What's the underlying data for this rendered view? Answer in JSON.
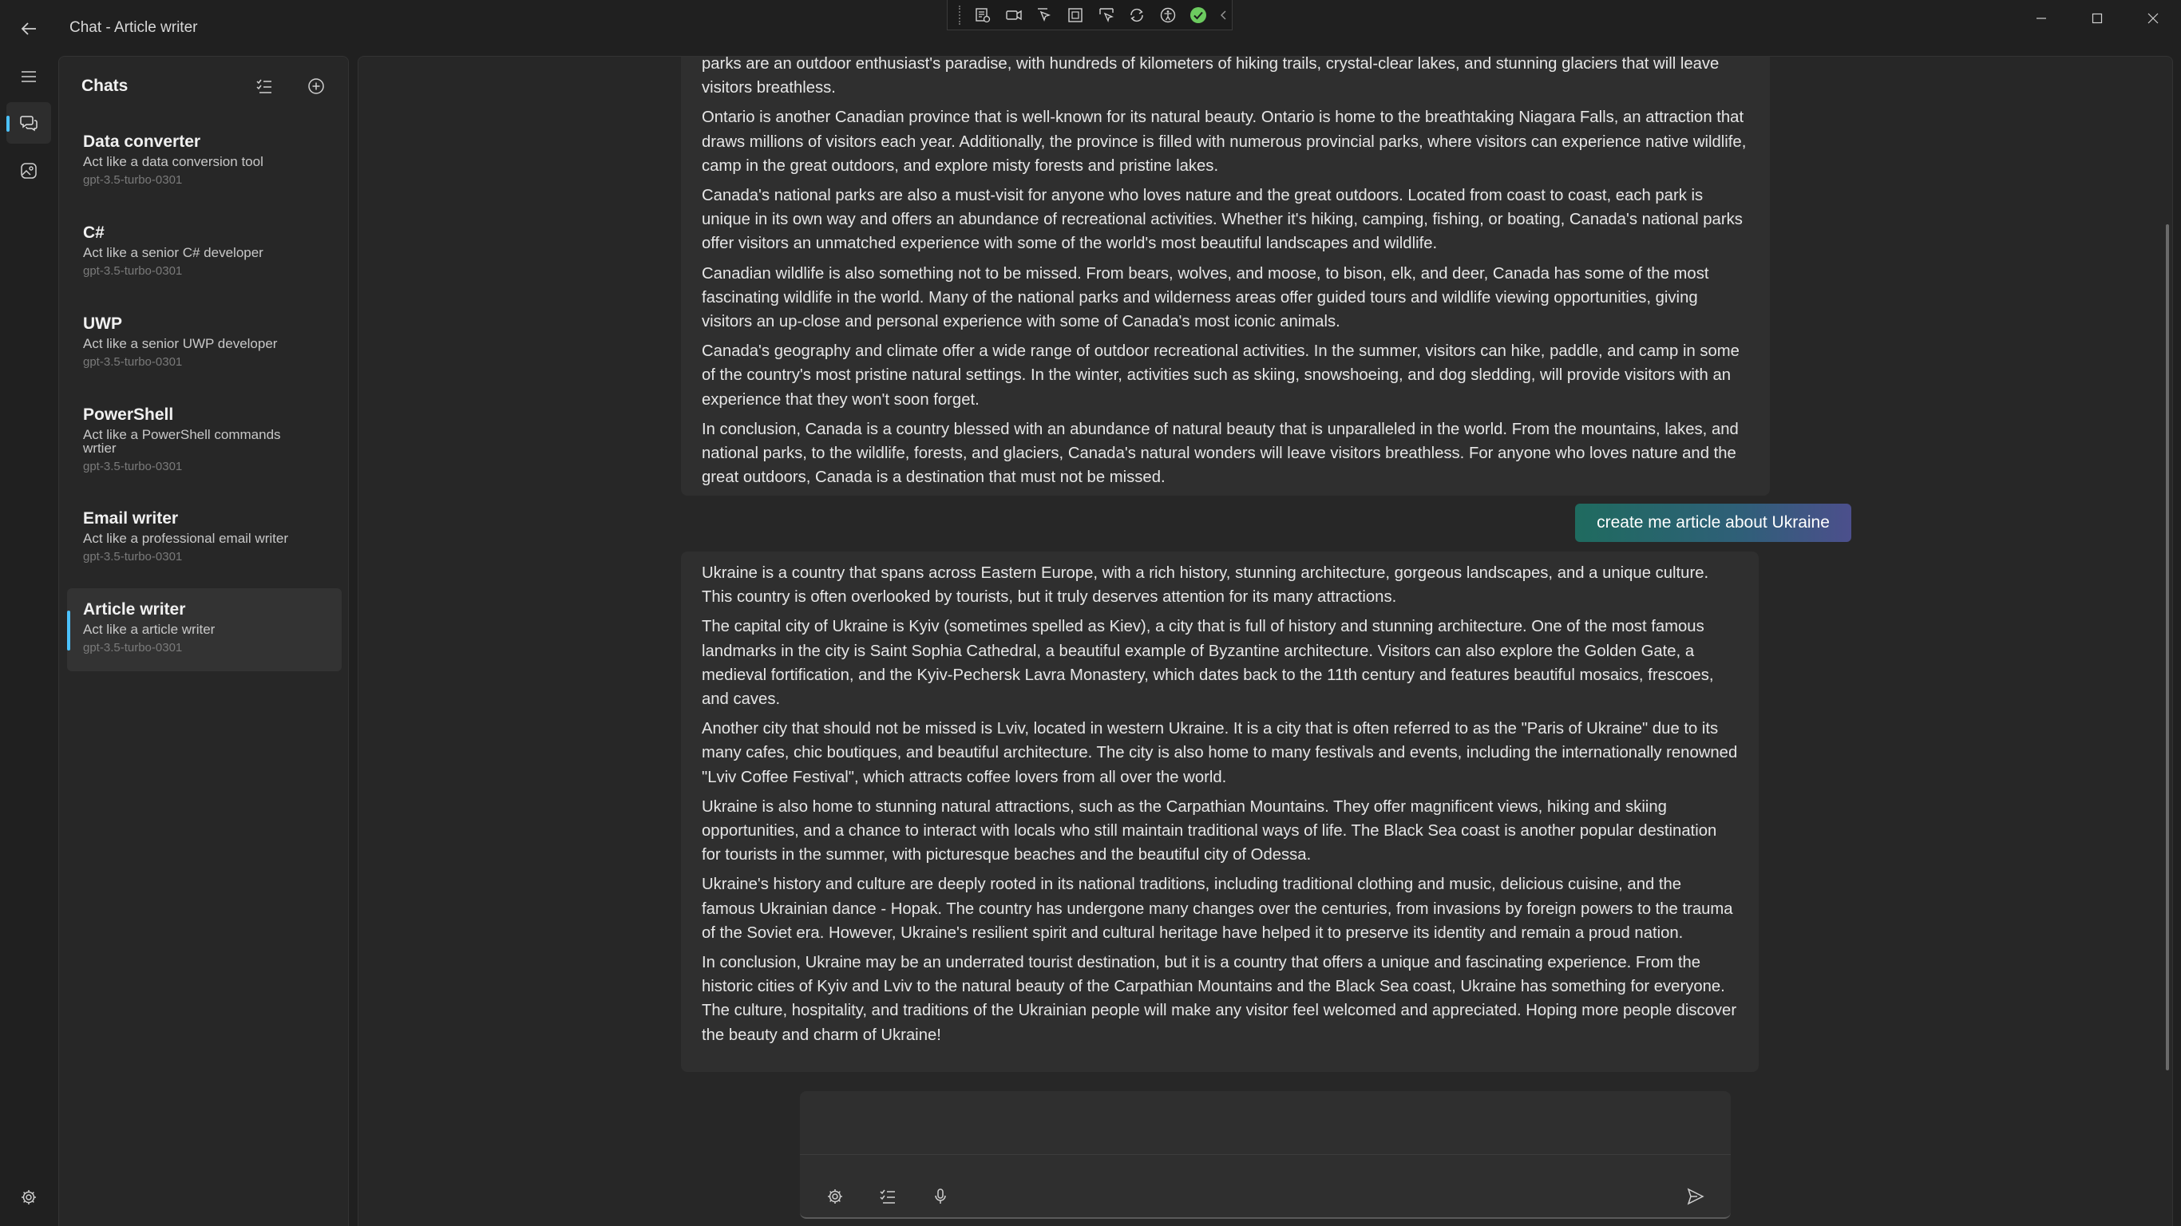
{
  "window": {
    "title": "Chat - Article writer"
  },
  "panel": {
    "title": "Chats",
    "items": [
      {
        "name": "Data converter",
        "description": "Act like a data conversion tool",
        "model": "gpt-3.5-turbo-0301"
      },
      {
        "name": "C#",
        "description": "Act like a senior C# developer",
        "model": "gpt-3.5-turbo-0301"
      },
      {
        "name": "UWP",
        "description": "Act like a senior UWP developer",
        "model": "gpt-3.5-turbo-0301"
      },
      {
        "name": "PowerShell",
        "description": "Act like a PowerShell commands wrtier",
        "model": "gpt-3.5-turbo-0301"
      },
      {
        "name": "Email writer",
        "description": "Act like a professional email writer",
        "model": "gpt-3.5-turbo-0301"
      },
      {
        "name": "Article writer",
        "description": "Act like a article writer",
        "model": "gpt-3.5-turbo-0301",
        "selected": true
      }
    ]
  },
  "conversation": {
    "canada_paragraphs": [
      "parks are an outdoor enthusiast's paradise, with hundreds of kilometers of hiking trails, crystal-clear lakes, and stunning glaciers that will leave visitors breathless.",
      "Ontario is another Canadian province that is well-known for its natural beauty. Ontario is home to the breathtaking Niagara Falls, an attraction that draws millions of visitors each year. Additionally, the province is filled with numerous provincial parks, where visitors can experience native wildlife, camp in the great outdoors, and explore misty forests and pristine lakes.",
      "Canada's national parks are also a must-visit for anyone who loves nature and the great outdoors. Located from coast to coast, each park is unique in its own way and offers an abundance of recreational activities. Whether it's hiking, camping, fishing, or boating, Canada's national parks offer visitors an unmatched experience with some of the world's most beautiful landscapes and wildlife.",
      "Canadian wildlife is also something not to be missed. From bears, wolves, and moose, to bison, elk, and deer, Canada has some of the most fascinating wildlife in the world. Many of the national parks and wilderness areas offer guided tours and wildlife viewing opportunities, giving visitors an up-close and personal experience with some of Canada's most iconic animals.",
      "Canada's geography and climate offer a wide range of outdoor recreational activities. In the summer, visitors can hike, paddle, and camp in some of the country's most pristine natural settings. In the winter, activities such as skiing, snowshoeing, and dog sledding, will provide visitors with an experience that they won't soon forget.",
      "In conclusion, Canada is a country blessed with an abundance of natural beauty that is unparalleled in the world. From the mountains, lakes, and national parks, to the wildlife, forests, and glaciers, Canada's natural wonders will leave visitors breathless. For anyone who loves nature and the great outdoors, Canada is a destination that must not be missed."
    ],
    "user_message": "create me article about Ukraine",
    "ukraine_paragraphs": [
      "Ukraine is a country that spans across Eastern Europe, with a rich history, stunning architecture, gorgeous landscapes, and a unique culture. This country is often overlooked by tourists, but it truly deserves attention for its many attractions.",
      "The capital city of Ukraine is Kyiv (sometimes spelled as Kiev), a city that is full of history and stunning architecture. One of the most famous landmarks in the city is Saint Sophia Cathedral, a beautiful example of Byzantine architecture. Visitors can also explore the Golden Gate, a medieval fortification, and the Kyiv-Pechersk Lavra Monastery, which dates back to the 11th century and features beautiful mosaics, frescoes, and caves.",
      "Another city that should not be missed is Lviv, located in western Ukraine. It is a city that is often referred to as the \"Paris of Ukraine\" due to its many cafes, chic boutiques, and beautiful architecture. The city is also home to many festivals and events, including the internationally renowned \"Lviv Coffee Festival\", which attracts coffee lovers from all over the world.",
      "Ukraine is also home to stunning natural attractions, such as the Carpathian Mountains. They offer magnificent views, hiking and skiing opportunities, and a chance to interact with locals who still maintain traditional ways of life. The Black Sea coast is another popular destination for tourists in the summer, with picturesque beaches and the beautiful city of Odessa.",
      "Ukraine's history and culture are deeply rooted in its national traditions, including traditional clothing and music, delicious cuisine, and the famous Ukrainian dance - Hopak. The country has undergone many changes over the centuries, from invasions by foreign powers to the trauma of the Soviet era. However, Ukraine's resilient spirit and cultural heritage have helped it to preserve its identity and remain a proud nation.",
      "In conclusion, Ukraine may be an underrated tourist destination, but it is a country that offers a unique and fascinating experience. From the historic cities of Kyiv and Lviv to the natural beauty of the Carpathian Mountains and the Black Sea coast, Ukraine has something for everyone. The culture, hospitality, and traditions of the Ukrainian people will make any visitor feel welcomed and appreciated. Hoping more people discover the beauty and charm of Ukraine!"
    ]
  },
  "composer": {
    "value": "",
    "placeholder": ""
  },
  "icons": {
    "back": "back-arrow-icon",
    "menu": "hamburger-icon",
    "chat": "chat-icon",
    "image": "image-icon",
    "settings": "gear-icon",
    "new_chat": "add-circle-icon",
    "manage": "checklist-icon",
    "mic": "microphone-icon",
    "send": "send-icon"
  },
  "colors": {
    "accent": "#4cc2ff",
    "background": "#202020",
    "surface": "#272727",
    "bubble": "#2f2f2f",
    "user_bubble_start": "#1f6b5f",
    "user_bubble_end": "#4c4f8c"
  }
}
